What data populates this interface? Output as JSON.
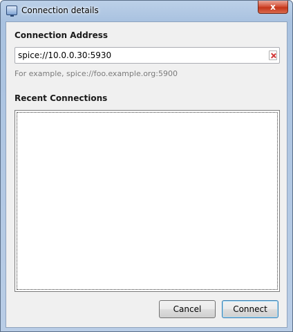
{
  "window": {
    "title": "Connection details",
    "close_label": "x"
  },
  "address": {
    "label": "Connection Address",
    "value": "spice://10.0.0.30:5930",
    "hint": "For example, spice://foo.example.org:5900"
  },
  "recent": {
    "label": "Recent Connections",
    "items": []
  },
  "buttons": {
    "cancel": "Cancel",
    "connect": "Connect"
  }
}
